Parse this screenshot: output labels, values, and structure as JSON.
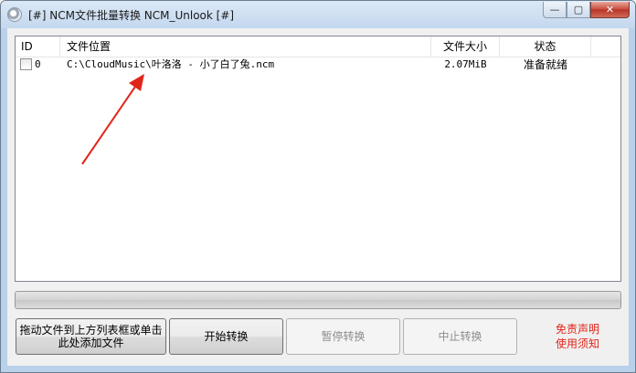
{
  "window": {
    "title": "[#] NCM文件批量转换 NCM_Unlook [#]",
    "caption": {
      "minimize": "—",
      "maximize": "▢",
      "close": "✕"
    }
  },
  "file_list": {
    "columns": [
      "ID",
      "文件位置",
      "文件大小",
      "状态"
    ],
    "rows": [
      {
        "checked": false,
        "id": "0",
        "path": "C:\\CloudMusic\\叶洛洛 - 小了白了兔.ncm",
        "size": "2.07MiB",
        "status": "准备就绪"
      }
    ]
  },
  "progress": {
    "value": 0
  },
  "buttons": {
    "add_files": "拖动文件到上方列表框或单击此处添加文件",
    "start": "开始转换",
    "pause": "暂停转换",
    "stop": "中止转换",
    "disclaimer": "免责声明",
    "notice": "使用须知"
  },
  "colors": {
    "annotation_arrow": "#e0261a",
    "link_text": "#e0261a",
    "progress_fill": "#4cc24c"
  }
}
